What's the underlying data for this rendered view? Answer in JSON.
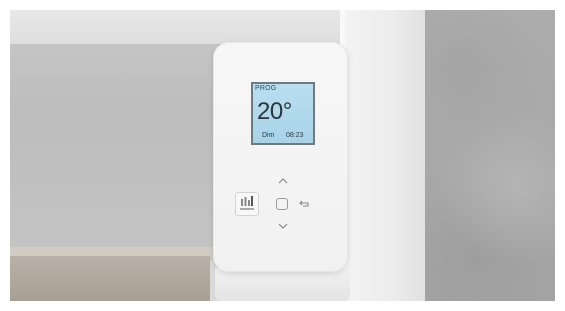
{
  "thermostat": {
    "screen": {
      "mode": "PROG",
      "temperature": "20°",
      "day": "Dim",
      "time": "08:23"
    },
    "buttons": {
      "up_icon": "chevron-up-icon",
      "ok_icon": "square-ok-icon",
      "down_icon": "chevron-down-icon",
      "back_icon": "return-arrow-icon"
    },
    "logo_icon": "brand-logo-icon"
  },
  "colors": {
    "lcd_background": "#b0d8ec",
    "device_body": "#f4f4f4",
    "wall_concrete": "#a8a8a8"
  }
}
